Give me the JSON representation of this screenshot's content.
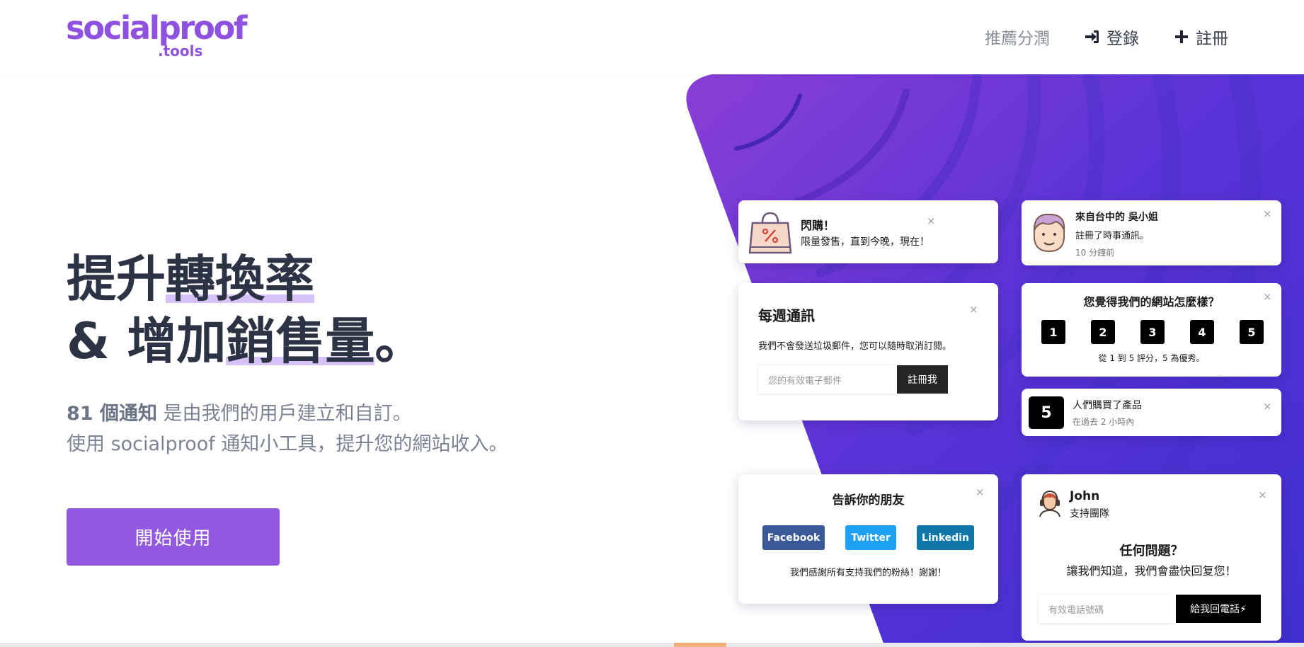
{
  "brand": {
    "logo_main": "socialproof",
    "logo_sub": ".tools",
    "accent_color": "#9259e0"
  },
  "nav": {
    "affiliate": "推薦分潤",
    "login": "登錄",
    "register": "註冊"
  },
  "hero": {
    "title_pre1": "提升",
    "title_hl1": "轉換率",
    "title_pre2": "& 增加",
    "title_hl2": "銷售量",
    "title_post2": "。",
    "desc_bold": "81 個通知",
    "desc_rest": " 是由我們的用戶建立和自訂。",
    "desc_line2": "使用 socialproof 通知小工具，提升您的網站收入。",
    "cta": "開始使用"
  },
  "cards": {
    "flash": {
      "title": "閃購！",
      "text": "限量發售，直到今晚，現在！",
      "close": "×"
    },
    "signup": {
      "title": "來自台中的 吳小姐",
      "text": "註冊了時事通訊。",
      "time": "10 分鐘前",
      "close": "×"
    },
    "newsletter": {
      "title": "每週通訊",
      "text": "我們不會發送垃圾郵件，您可以隨時取消訂閱。",
      "placeholder": "您的有效電子郵件",
      "button": "註冊我",
      "close": "×"
    },
    "rating": {
      "title": "您覺得我們的網站怎麼樣？",
      "options": [
        "1",
        "2",
        "3",
        "4",
        "5"
      ],
      "hint": "從 1 到 5 評分，5 為優秀。",
      "close": "×"
    },
    "bought": {
      "count": "5",
      "text": "人們購買了產品",
      "time": "在過去 2 小時內",
      "close": "×"
    },
    "share": {
      "title": "告訴你的朋友",
      "facebook": "Facebook",
      "twitter": "Twitter",
      "linkedin": "Linkedin",
      "text": "我們感謝所有支持我們的粉絲！謝謝！",
      "close": "×"
    },
    "support": {
      "name": "John",
      "role": "支持團隊",
      "question": "任何問題？",
      "text": "讓我們知道，我們會盡快回复您！",
      "placeholder": "有效電話號碼",
      "button": "給我回電話⚡",
      "close": "×"
    }
  }
}
